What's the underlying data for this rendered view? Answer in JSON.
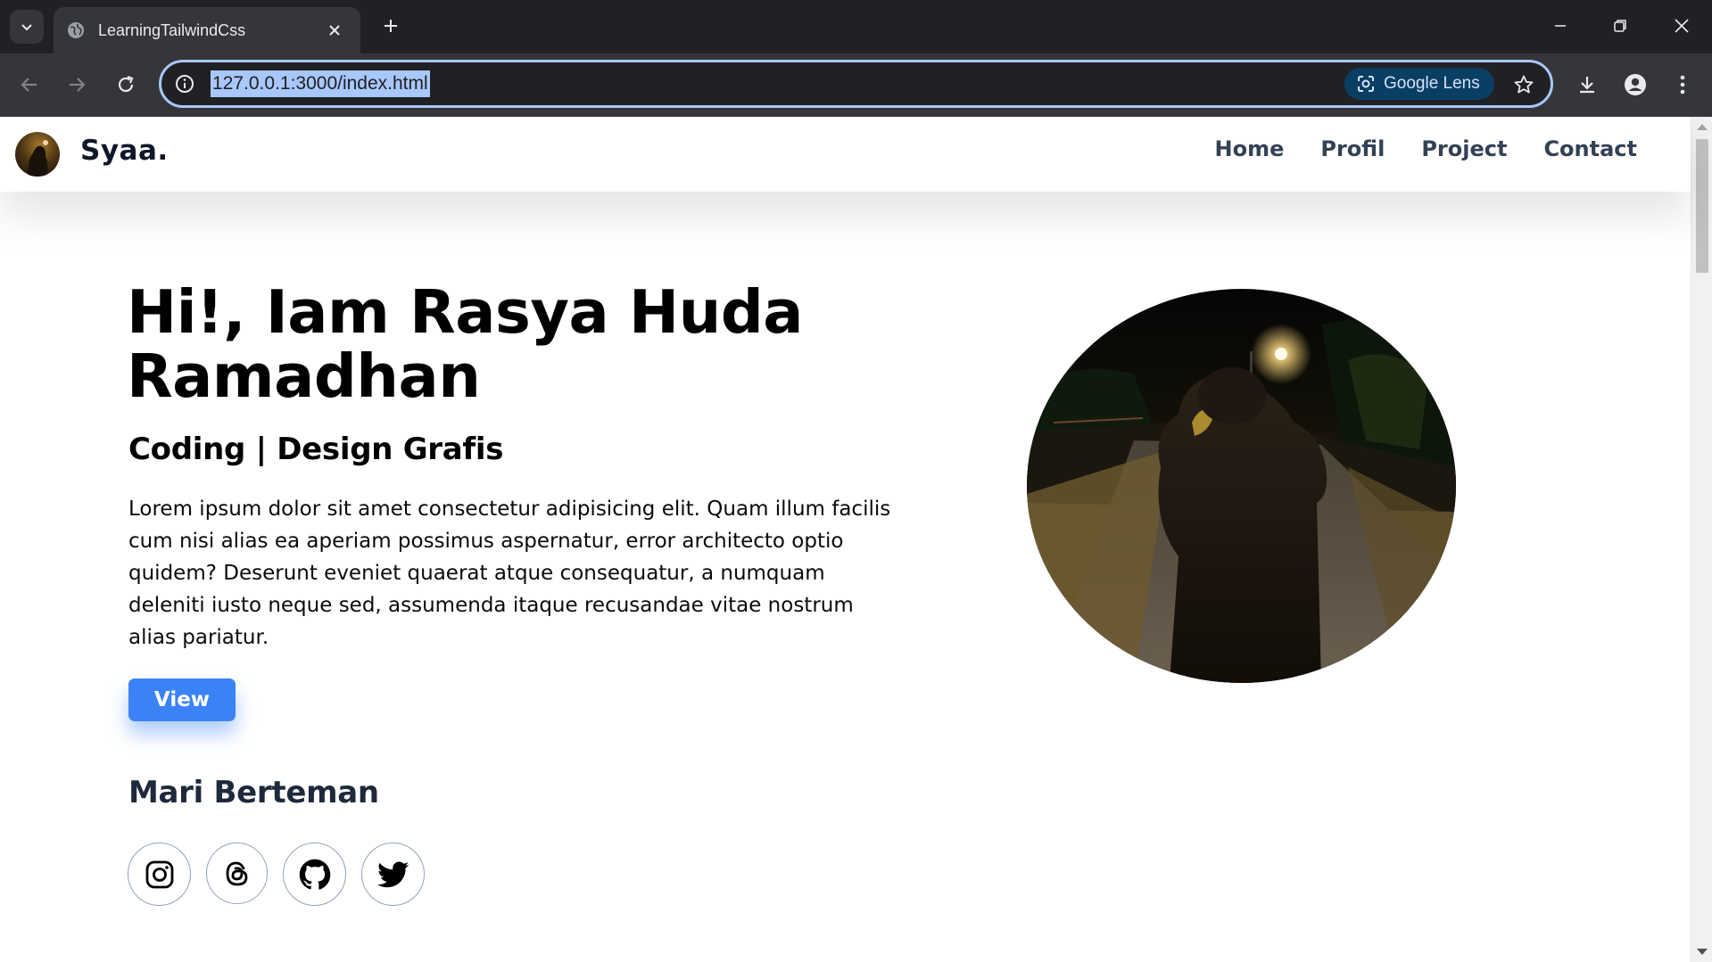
{
  "browser": {
    "tab_title": "LearningTailwindCss",
    "url": "127.0.0.1:3000/index.html",
    "lens_label": "Google Lens"
  },
  "site": {
    "brand": "Syaa.",
    "nav": [
      "Home",
      "Profil",
      "Project",
      "Contact"
    ]
  },
  "hero": {
    "title": "Hi!, Iam Rasya Huda Ramadhan",
    "subtitle": "Coding | Design Grafis",
    "description": "Lorem ipsum dolor sit amet consectetur adipisicing elit. Quam illum facilis cum nisi alias ea aperiam possimus aspernatur, error architecto optio quidem? Deserunt eveniet quaerat atque consequatur, a numquam deleniti iusto neque sed, assumenda itaque recusandae vitae nostrum alias pariatur.",
    "button_label": "View"
  },
  "friends": {
    "title": "Mari Berteman",
    "icons": [
      "instagram-icon",
      "threads-icon",
      "github-icon",
      "twitter-icon"
    ]
  },
  "colors": {
    "accent": "#3b82f6",
    "chrome_dark": "#202124",
    "chrome_toolbar": "#35363a",
    "omnibox_border": "#a8c7fa"
  }
}
